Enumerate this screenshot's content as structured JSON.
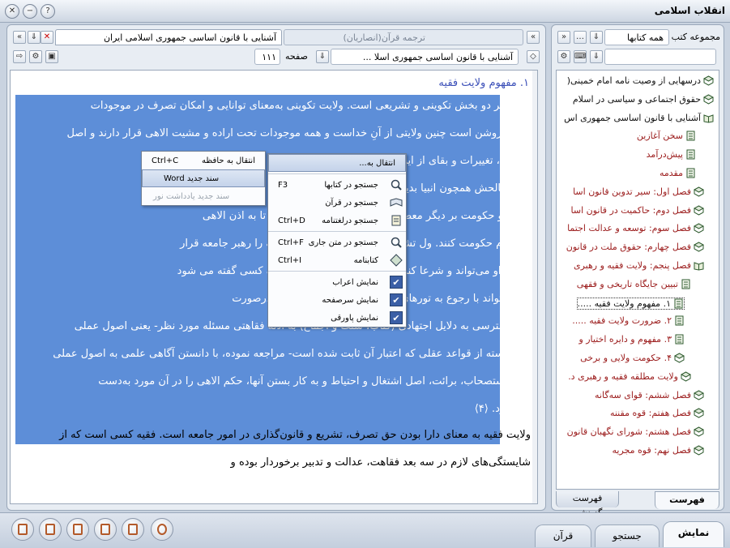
{
  "window": {
    "title": "انقلاب اسلامی"
  },
  "doc_tabs": {
    "active_tab": "آشنایی با قانون اساسی جمهوری اسلامی ایران",
    "inactive_tab": "ترجمه قرآن(انصاریان)",
    "nav_left": "«",
    "nav_right": "«"
  },
  "doc_toolbar": {
    "book_field": "آشنایی با قانون اساسی جمهوری اسلا ...",
    "page_label": "صفحه",
    "page_value": "۱۱۱"
  },
  "sidebar": {
    "label": "مجموعه کتب",
    "collection_select": "همه کتابها",
    "search_placeholder": "",
    "tabs": [
      "فهرست درختی",
      "فهرست گزینشی"
    ]
  },
  "content": {
    "heading": "۱. مفهوم ولایت فقیه",
    "selected_lines": [
      "ولایت بر دو بخش تکوینی و تشریعی است. ولایت تکوینی به‌معنای توانایی و امکان تصرف در موجودات",
      "است. روشن است چنین ولایتی از آنِ خداست و همه موجودات تحت اراده و مشیت الاهی قرار دارند و اصل",
      "پیدایش، تغییرات و بقای                                                              از این ولایت را به برخی از",
      "عباد صالحش همچون انبیا                                                            بدین معناست که خداوند",
      "ولایت و حکومت بر دیگر                                     معصومین (علیهم السلام) قرار داده تا به اذن الاهی",
      "بر مردم حکومت کنند. ول                                    تشریعی؛ بدین بیان که خداوند فقیه را رهبر جامعه قرار",
      "داده و او می‌تواند و شرعا                                          کند. ⟨۲⟩ بر پایه اصول فقه، فقیه به کسی گفته می شود",
      "که می‌تواند با رجوع به                                           تورهای دینی را استنباط کند. ⟨۳⟩ وی درصورت",
      "عدم‌دسترسی به دلایل اجتهادی (کتاب، سنت و اجماع) به ادلهٔ فقاهتی مسئله مورد نظر- یعنی اصول عملی",
      "و آن دسته از قواعد عقلی که اعتبار آن ثابت شده است- مراجعه نموده، با دانستن آگاهی علمی به اصول عملی",
      "چون استصحاب، برائت، اصل اشتغال و احتیاط و به کار بستن آنها، حکم الاهی را در آن مورد به‌دست",
      "می آورد. ⟨۴⟩"
    ],
    "plain_lines": [
      "ولایت فقیه به معنای دارا بودن حق تصرف، تشریع و قانون‌گذاری در امور جامعه است. فقیه کسی است که از",
      "شایستگی‌های لازم در سه بعد فقاهت، عدالت و تدبیر برخوردار بوده و"
    ]
  },
  "tree": [
    {
      "label": "درسهایی از وصیت نامه امام خمینی(",
      "color": "dark",
      "icon": "book-icon"
    },
    {
      "label": "حقوق اجتماعی و سیاسی در اسلام",
      "color": "dark",
      "icon": "book-icon"
    },
    {
      "label": "آشنایی با قانون اساسی جمهوری اس",
      "color": "dark",
      "icon": "open-book-icon"
    },
    {
      "label": "سخن آغازین",
      "color": "red",
      "icon": "page-icon"
    },
    {
      "label": "پیش‌درآمد",
      "color": "red",
      "icon": "page-icon"
    },
    {
      "label": "مقدمه",
      "color": "red",
      "icon": "page-icon"
    },
    {
      "label": "فصل اول: سیر تدوین قانون اسا",
      "color": "red",
      "icon": "book-icon"
    },
    {
      "label": "فصل دوم: حاکمیت در قانون اسا",
      "color": "red",
      "icon": "book-icon"
    },
    {
      "label": "فصل سوم: توسعه و عدالت اجتما",
      "color": "red",
      "icon": "book-icon"
    },
    {
      "label": "فصل چهارم: حقوق ملت در قانون",
      "color": "red",
      "icon": "book-icon"
    },
    {
      "label": "فصل پنجم: ولایت فقیه و رهبری",
      "color": "red",
      "icon": "open-book-icon"
    },
    {
      "label": "تبیین جایگاه تاریخی و فقهی",
      "color": "red",
      "icon": "page-icon"
    },
    {
      "label": "۱. مفهوم ولایت فقیه .....",
      "color": "dark",
      "icon": "page-icon",
      "selected": true
    },
    {
      "label": "۲. ضرورت ولایت فقیه .....",
      "color": "red",
      "icon": "page-icon"
    },
    {
      "label": "۳. مفهوم و دایره اختیار و",
      "color": "red",
      "icon": "page-icon"
    },
    {
      "label": "۴. حکومت ولایی و برخی",
      "color": "red",
      "icon": "book-icon"
    },
    {
      "label": "ولایت مطلقه فقیه و رهبری د.",
      "color": "red",
      "icon": "book-icon"
    },
    {
      "label": "فصل ششم: قوای سه‌گانه",
      "color": "red",
      "icon": "book-icon"
    },
    {
      "label": "فصل هفتم: قوه مقننه",
      "color": "red",
      "icon": "book-icon"
    },
    {
      "label": "فصل هشتم: شورای نگهبان قانون",
      "color": "red",
      "icon": "book-icon"
    },
    {
      "label": "فصل نهم: قوه مجریه",
      "color": "red",
      "icon": "book-icon"
    }
  ],
  "menu_main": {
    "top": "انتقال به...",
    "items": [
      {
        "label": "جستجو در کتابها",
        "shortcut": "F3",
        "icon": "search-icon"
      },
      {
        "label": "جستجو در قرآن",
        "shortcut": "",
        "icon": "quran-icon"
      },
      {
        "label": "جستجو درلغتنامه",
        "shortcut": "Ctrl+D",
        "icon": "dictionary-icon"
      },
      {
        "label": "جستجو در متن جاری",
        "shortcut": "Ctrl+F",
        "icon": "search-icon"
      },
      {
        "label": "کتابنامه",
        "shortcut": "Ctrl+I",
        "icon": "bibliography-icon"
      }
    ],
    "checks": [
      {
        "label": "نمایش اعراب"
      },
      {
        "label": "نمایش سرصفحه"
      },
      {
        "label": "نمایش پاورقی"
      }
    ]
  },
  "menu_sub": {
    "items": [
      {
        "label": "انتقال به حافظه",
        "shortcut": "Ctrl+C",
        "disabled": false
      },
      {
        "label": "سند جدید Word",
        "shortcut": "",
        "disabled": false,
        "highlight": true
      },
      {
        "label": "سند جدید یادداشت نور",
        "shortcut": "",
        "disabled": true
      }
    ]
  },
  "bottom_tabs": [
    "نمایش",
    "جستجو",
    "قرآن"
  ],
  "colors": {
    "selection": "#5d8ed8",
    "heading": "#3b4fb8",
    "tree_red": "#9b1b1b",
    "reference": "#e8c23a"
  }
}
